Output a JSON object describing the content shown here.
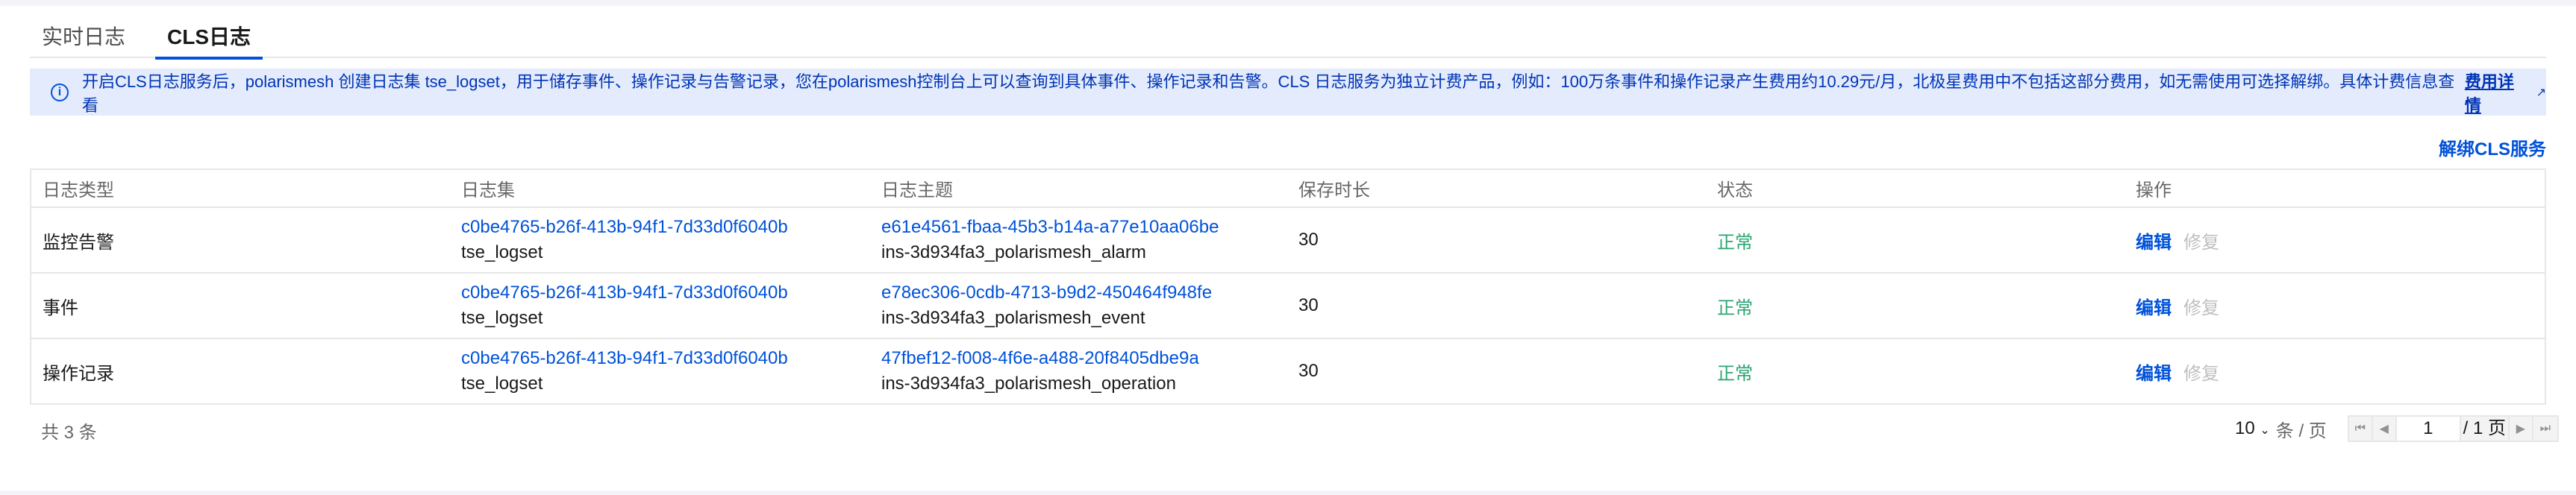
{
  "tabs": [
    {
      "label": "实时日志"
    },
    {
      "label": "CLS日志"
    }
  ],
  "alert": {
    "text": "开启CLS日志服务后，polarismesh 创建日志集 tse_logset，用于储存事件、操作记录与告警记录，您在polarismesh控制台上可以查询到具体事件、操作记录和告警。CLS 日志服务为独立计费产品，例如：100万条事件和操作记录产生费用约10.29元/月，北极星费用中不包括这部分费用，如无需使用可选择解绑。具体计费信息查看",
    "link": "费用详情",
    "icon": "info-icon"
  },
  "unbind_label": "解绑CLS服务",
  "table": {
    "headers": [
      "日志类型",
      "日志集",
      "日志主题",
      "保存时长",
      "状态",
      "操作"
    ],
    "rows": [
      {
        "type": "监控告警",
        "logset_id": "c0be4765-b26f-413b-94f1-7d33d0f6040b",
        "logset_name": "tse_logset",
        "topic_id": "e61e4561-fbaa-45b3-b14a-a77e10aa06be",
        "topic_name": "ins-3d934fa3_polarismesh_alarm",
        "retention": "30",
        "status": "正常",
        "edit": "编辑",
        "repair": "修复"
      },
      {
        "type": "事件",
        "logset_id": "c0be4765-b26f-413b-94f1-7d33d0f6040b",
        "logset_name": "tse_logset",
        "topic_id": "e78ec306-0cdb-4713-b9d2-450464f948fe",
        "topic_name": "ins-3d934fa3_polarismesh_event",
        "retention": "30",
        "status": "正常",
        "edit": "编辑",
        "repair": "修复"
      },
      {
        "type": "操作记录",
        "logset_id": "c0be4765-b26f-413b-94f1-7d33d0f6040b",
        "logset_name": "tse_logset",
        "topic_id": "47fbef12-f008-4f6e-a488-20f8405dbe9a",
        "topic_name": "ins-3d934fa3_polarismesh_operation",
        "retention": "30",
        "status": "正常",
        "edit": "编辑",
        "repair": "修复"
      }
    ]
  },
  "footer": {
    "total": "共 3 条",
    "page_size": "10",
    "page_size_unit": "条 / 页",
    "current_page": "1",
    "total_pages": "/ 1 页"
  },
  "colors": {
    "accent": "#0052d9",
    "success": "#2ba471",
    "alert_bg": "#e3ebfd"
  }
}
